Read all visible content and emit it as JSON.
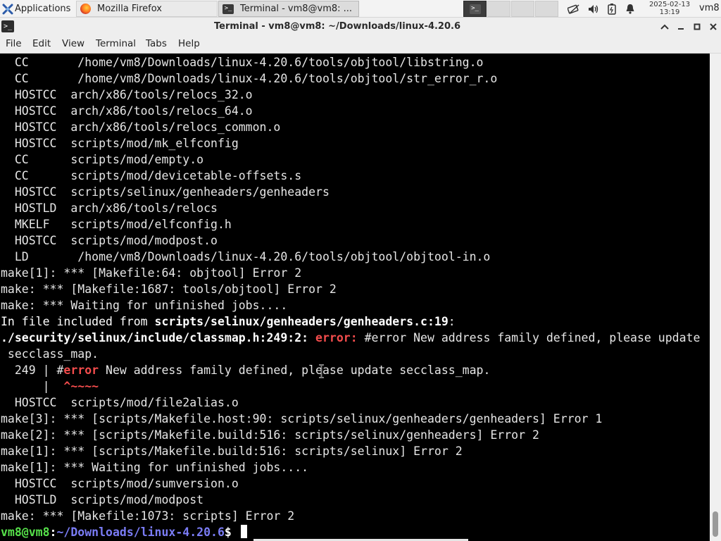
{
  "panel": {
    "apps_label": "Applications",
    "tasks": [
      {
        "label": "Mozilla Firefox",
        "icon": "firefox-icon"
      },
      {
        "label": "Terminal - vm8@vm8: ...",
        "icon": "terminal-icon"
      }
    ],
    "clock_date": "2025-02-13",
    "clock_time": "13:19",
    "user": "vm8"
  },
  "window": {
    "title": "Terminal - vm8@vm8: ~/Downloads/linux-4.20.6"
  },
  "menu": [
    "File",
    "Edit",
    "View",
    "Terminal",
    "Tabs",
    "Help"
  ],
  "terminal": {
    "lines": [
      "  CC       /home/vm8/Downloads/linux-4.20.6/tools/objtool/libstring.o",
      "  CC       /home/vm8/Downloads/linux-4.20.6/tools/objtool/str_error_r.o",
      "  HOSTCC  arch/x86/tools/relocs_32.o",
      "  HOSTCC  arch/x86/tools/relocs_64.o",
      "  HOSTCC  arch/x86/tools/relocs_common.o",
      "  HOSTCC  scripts/mod/mk_elfconfig",
      "  CC      scripts/mod/empty.o",
      "  CC      scripts/mod/devicetable-offsets.s",
      "  HOSTCC  scripts/selinux/genheaders/genheaders",
      "  HOSTLD  arch/x86/tools/relocs",
      "  MKELF   scripts/mod/elfconfig.h",
      "  HOSTCC  scripts/mod/modpost.o",
      "  LD       /home/vm8/Downloads/linux-4.20.6/tools/objtool/objtool-in.o",
      "make[1]: *** [Makefile:64: objtool] Error 2",
      "make: *** [Makefile:1687: tools/objtool] Error 2",
      "make: *** Waiting for unfinished jobs...."
    ],
    "included_prefix": "In file included from ",
    "included_file": "scripts/selinux/genheaders/genheaders.c:19",
    "included_suffix": ":",
    "err_loc": "./security/selinux/include/classmap.h:249:2:",
    "err_word": "error:",
    "err_msg": " #error New address family defined, please update",
    "err_cont": " secclass_map.",
    "src_lineno": "  249 | #",
    "src_err": "error",
    "src_rest": " New address family defined, please update secclass_map.",
    "caret_prefix": "      |  ",
    "caret": "^~~~~",
    "lines2": [
      "  HOSTCC  scripts/mod/file2alias.o",
      "make[3]: *** [scripts/Makefile.host:90: scripts/selinux/genheaders/genheaders] Error 1",
      "make[2]: *** [scripts/Makefile.build:516: scripts/selinux/genheaders] Error 2",
      "make[1]: *** [scripts/Makefile.build:516: scripts/selinux] Error 2",
      "make[1]: *** Waiting for unfinished jobs....",
      "  HOSTCC  scripts/mod/sumversion.o",
      "  HOSTLD  scripts/mod/modpost",
      "make: *** [Makefile:1073: scripts] Error 2"
    ],
    "prompt_user": "vm8@vm8",
    "prompt_sep": ":",
    "prompt_path": "~/Downloads/linux-4.20.6",
    "prompt_end": "$ "
  }
}
